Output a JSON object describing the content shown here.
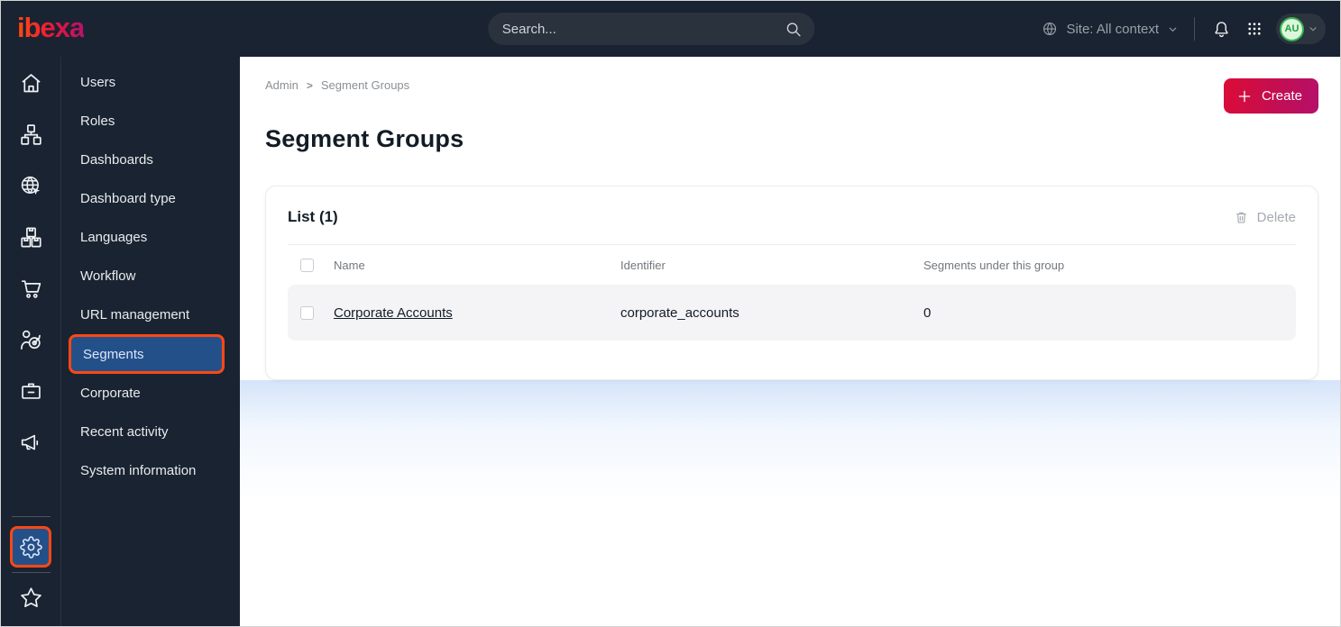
{
  "colors": {
    "topbar_bg": "#1a2331",
    "accent_orange": "#ff4713",
    "active_item_blue": "#24508a",
    "primary_button_gradient_start": "#dc0c37",
    "primary_button_gradient_end": "#b4106a",
    "avatar_green": "#35b24a"
  },
  "topbar": {
    "logo_text": "ibexa",
    "search_placeholder": "Search...",
    "site_context_label": "Site: All context",
    "avatar_initials": "AU",
    "icons": [
      "globe-icon",
      "chevron-down-icon",
      "bell-icon",
      "app-grid-icon"
    ]
  },
  "sidebar": {
    "rail_icons": [
      "home-icon",
      "content-tree-icon",
      "site-globe-icon",
      "products-boxes-icon",
      "commerce-cart-icon",
      "personalization-target-icon",
      "corporate-badge-icon",
      "marketing-megaphone-icon",
      "settings-gear-icon",
      "bookmarks-star-icon"
    ],
    "active_rail_icon": "settings-gear-icon",
    "menu_items": [
      {
        "label": "Users"
      },
      {
        "label": "Roles"
      },
      {
        "label": "Dashboards"
      },
      {
        "label": "Dashboard type"
      },
      {
        "label": "Languages"
      },
      {
        "label": "Workflow"
      },
      {
        "label": "URL management"
      },
      {
        "label": "Segments",
        "active": true
      },
      {
        "label": "Corporate"
      },
      {
        "label": "Recent activity"
      },
      {
        "label": "System information"
      }
    ]
  },
  "main": {
    "breadcrumb": {
      "items": [
        "Admin",
        "Segment Groups"
      ],
      "separator": ">"
    },
    "page_title": "Segment Groups",
    "create_button": {
      "label": "Create",
      "icon": "plus-icon"
    },
    "list_card": {
      "title": "List (1)",
      "delete_button": {
        "label": "Delete",
        "icon": "trash-icon",
        "enabled": false
      },
      "table": {
        "columns": [
          "Name",
          "Identifier",
          "Segments under this group"
        ],
        "rows": [
          {
            "name": "Corporate Accounts",
            "identifier": "corporate_accounts",
            "segments_count": "0",
            "checked": false
          }
        ]
      }
    }
  }
}
